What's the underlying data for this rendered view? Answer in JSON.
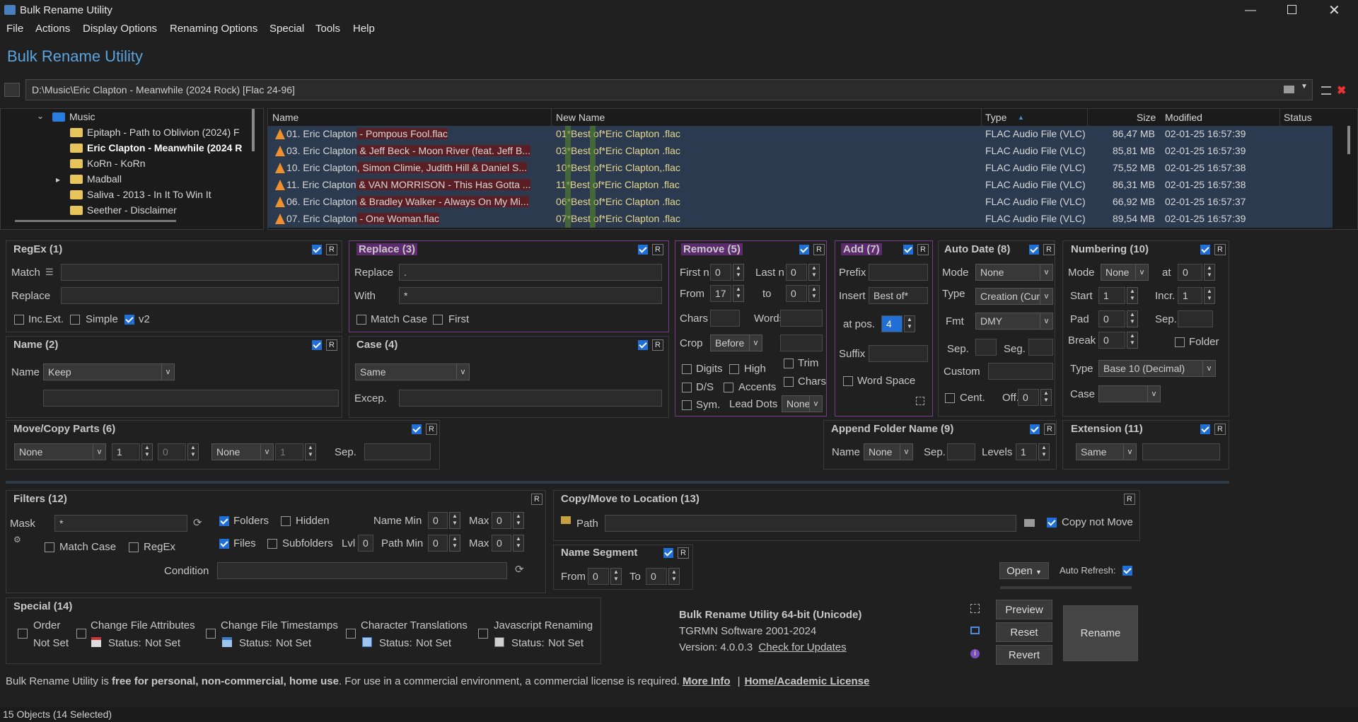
{
  "window": {
    "title": "Bulk Rename Utility"
  },
  "menu": [
    "File",
    "Actions",
    "Display Options",
    "Renaming Options",
    "Special",
    "Tools",
    "Help"
  ],
  "app_title": "Bulk Rename Utility",
  "path": "D:\\Music\\Eric Clapton - Meanwhile (2024 Rock) [Flac 24-96]",
  "tree": {
    "root": "Music",
    "items": [
      {
        "label": "Epitaph - Path to Oblivion (2024) F",
        "bold": false,
        "expand": false
      },
      {
        "label": "Eric Clapton - Meanwhile (2024 R",
        "bold": true,
        "expand": false
      },
      {
        "label": "KoRn - KoRn",
        "bold": false,
        "expand": false
      },
      {
        "label": "Madball",
        "bold": false,
        "expand": true
      },
      {
        "label": "Saliva - 2013 - In It To Win It",
        "bold": false,
        "expand": false
      },
      {
        "label": "Seether - Disclaimer",
        "bold": false,
        "expand": false
      }
    ]
  },
  "filelist": {
    "columns": [
      "Name",
      "New Name",
      "Type",
      "Size",
      "Modified",
      "Status"
    ],
    "rows": [
      {
        "pre": "01. Eric Clapton",
        "mid": " - Pompous Fool.flac",
        "new": "01*Best of*Eric Clapton .flac",
        "type": "FLAC Audio File (VLC)",
        "size": "86,47 MB",
        "modified": "02-01-25 16:57:39"
      },
      {
        "pre": "03. Eric Clapton",
        "mid": " & Jeff Beck - Moon River (feat. Jeff B...",
        "new": "03*Best of*Eric Clapton .flac",
        "type": "FLAC Audio File (VLC)",
        "size": "85,81 MB",
        "modified": "02-01-25 16:57:39"
      },
      {
        "pre": "10. Eric Clapton",
        "mid": ", Simon Climie, Judith Hill & Daniel S...",
        "new": "10*Best of*Eric Clapton,.flac",
        "type": "FLAC Audio File (VLC)",
        "size": "75,52 MB",
        "modified": "02-01-25 16:57:38"
      },
      {
        "pre": "11. Eric Clapton",
        "mid": " & VAN MORRISON - This Has Gotta ...",
        "new": "11*Best of*Eric Clapton .flac",
        "type": "FLAC Audio File (VLC)",
        "size": "86,31 MB",
        "modified": "02-01-25 16:57:38"
      },
      {
        "pre": "06. Eric Clapton",
        "mid": " & Bradley Walker - Always On My Mi...",
        "new": "06*Best of*Eric Clapton .flac",
        "type": "FLAC Audio File (VLC)",
        "size": "66,92 MB",
        "modified": "02-01-25 16:57:37"
      },
      {
        "pre": "07. Eric Clapton",
        "mid": " - One Woman.flac",
        "new": "07*Best of*Eric Clapton .flac",
        "type": "FLAC Audio File (VLC)",
        "size": "89,54 MB",
        "modified": "02-01-25 16:57:39"
      }
    ]
  },
  "regex": {
    "title": "RegEx (1)",
    "match": "Match",
    "replace": "Replace",
    "incext": "Inc.Ext.",
    "simple": "Simple",
    "v2": "v2"
  },
  "replace": {
    "title": "Replace (3)",
    "replace_lbl": "Replace",
    "replace_val": ".",
    "with_lbl": "With",
    "with_val": "*",
    "matchcase": "Match Case",
    "first": "First"
  },
  "remove": {
    "title": "Remove (5)",
    "firstn": "First n",
    "firstn_val": "0",
    "lastn": "Last n",
    "lastn_val": "0",
    "from": "From",
    "from_val": "17",
    "to": "to",
    "to_val": "0",
    "chars": "Chars",
    "words": "Words",
    "crop": "Crop",
    "crop_val": "Before",
    "digits": "Digits",
    "high": "High",
    "trim": "Trim",
    "ds": "D/S",
    "accents": "Accents",
    "chars2": "Chars",
    "sym": "Sym.",
    "leaddots": "Lead Dots",
    "leaddots_val": "None"
  },
  "add": {
    "title": "Add (7)",
    "prefix": "Prefix",
    "insert": "Insert",
    "insert_val": "Best of*",
    "atpos": "at pos.",
    "atpos_val": "4",
    "suffix": "Suffix",
    "wordspace": "Word Space"
  },
  "autodate": {
    "title": "Auto Date (8)",
    "mode": "Mode",
    "mode_val": "None",
    "type": "Type",
    "type_val": "Creation (Cur",
    "fmt": "Fmt",
    "fmt_val": "DMY",
    "sep": "Sep.",
    "seg": "Seg.",
    "custom": "Custom",
    "cent": "Cent.",
    "off": "Off.",
    "off_val": "0"
  },
  "numbering": {
    "title": "Numbering (10)",
    "mode": "Mode",
    "mode_val": "None",
    "at": "at",
    "at_val": "0",
    "start": "Start",
    "start_val": "1",
    "incr": "Incr.",
    "incr_val": "1",
    "pad": "Pad",
    "pad_val": "0",
    "sep": "Sep.",
    "break": "Break",
    "break_val": "0",
    "folder": "Folder",
    "type": "Type",
    "type_val": "Base 10 (Decimal)",
    "case": "Case"
  },
  "name": {
    "title": "Name (2)",
    "name_lbl": "Name",
    "name_val": "Keep"
  },
  "case": {
    "title": "Case (4)",
    "case_val": "Same",
    "excep": "Excep."
  },
  "movecopy": {
    "title": "Move/Copy Parts (6)",
    "sel1": "None",
    "n1": "1",
    "n2": "0",
    "sel2": "None",
    "n3": "1",
    "sep": "Sep."
  },
  "appendfolder": {
    "title": "Append Folder Name (9)",
    "name": "Name",
    "name_val": "None",
    "sep": "Sep.",
    "levels": "Levels",
    "levels_val": "1"
  },
  "extension": {
    "title": "Extension (11)",
    "val": "Same"
  },
  "filters": {
    "title": "Filters (12)",
    "mask": "Mask",
    "mask_val": "*",
    "folders": "Folders",
    "hidden": "Hidden",
    "files": "Files",
    "subfolders": "Subfolders",
    "lvl": "Lvl",
    "lvl_val": "0",
    "namemin": "Name Min",
    "namemin_val": "0",
    "max": "Max",
    "max_val": "0",
    "pathmin": "Path Min",
    "pathmin_val": "0",
    "max2_val": "0",
    "matchcase": "Match Case",
    "regex": "RegEx",
    "condition": "Condition"
  },
  "copymove": {
    "title": "Copy/Move to Location (13)",
    "path": "Path",
    "copynotmove": "Copy not Move"
  },
  "namesegment": {
    "title": "Name Segment",
    "from": "From",
    "from_val": "0",
    "to": "To",
    "to_val": "0"
  },
  "special": {
    "title": "Special (14)",
    "order": "Order",
    "order_status": "Not Set",
    "cfa": "Change File Attributes",
    "cft": "Change File Timestamps",
    "ct": "Character Translations",
    "js": "Javascript Renaming",
    "status": "Status:",
    "notset": "Not Set"
  },
  "about": {
    "line1": "Bulk Rename Utility 64-bit (Unicode)",
    "line2": "TGRMN Software 2001-2024",
    "line3": "Version: 4.0.0.3",
    "link": "Check for Updates"
  },
  "buttons": {
    "open": "Open",
    "autorefresh": "Auto Refresh:",
    "preview": "Preview",
    "reset": "Reset",
    "revert": "Revert",
    "rename": "Rename"
  },
  "license": {
    "t1": "Bulk Rename Utility is ",
    "t2": "free for personal, non-commercial, home use",
    "t3": ". For use in a commercial environment, a commercial license is required. ",
    "more": "More Info",
    "sep": "|",
    "home": "Home/Academic License"
  },
  "status": "15 Objects (14 Selected)",
  "colors": {
    "accent": "#5ba4de",
    "purple": "#7a3b8c",
    "check": "#1f6fd6"
  }
}
